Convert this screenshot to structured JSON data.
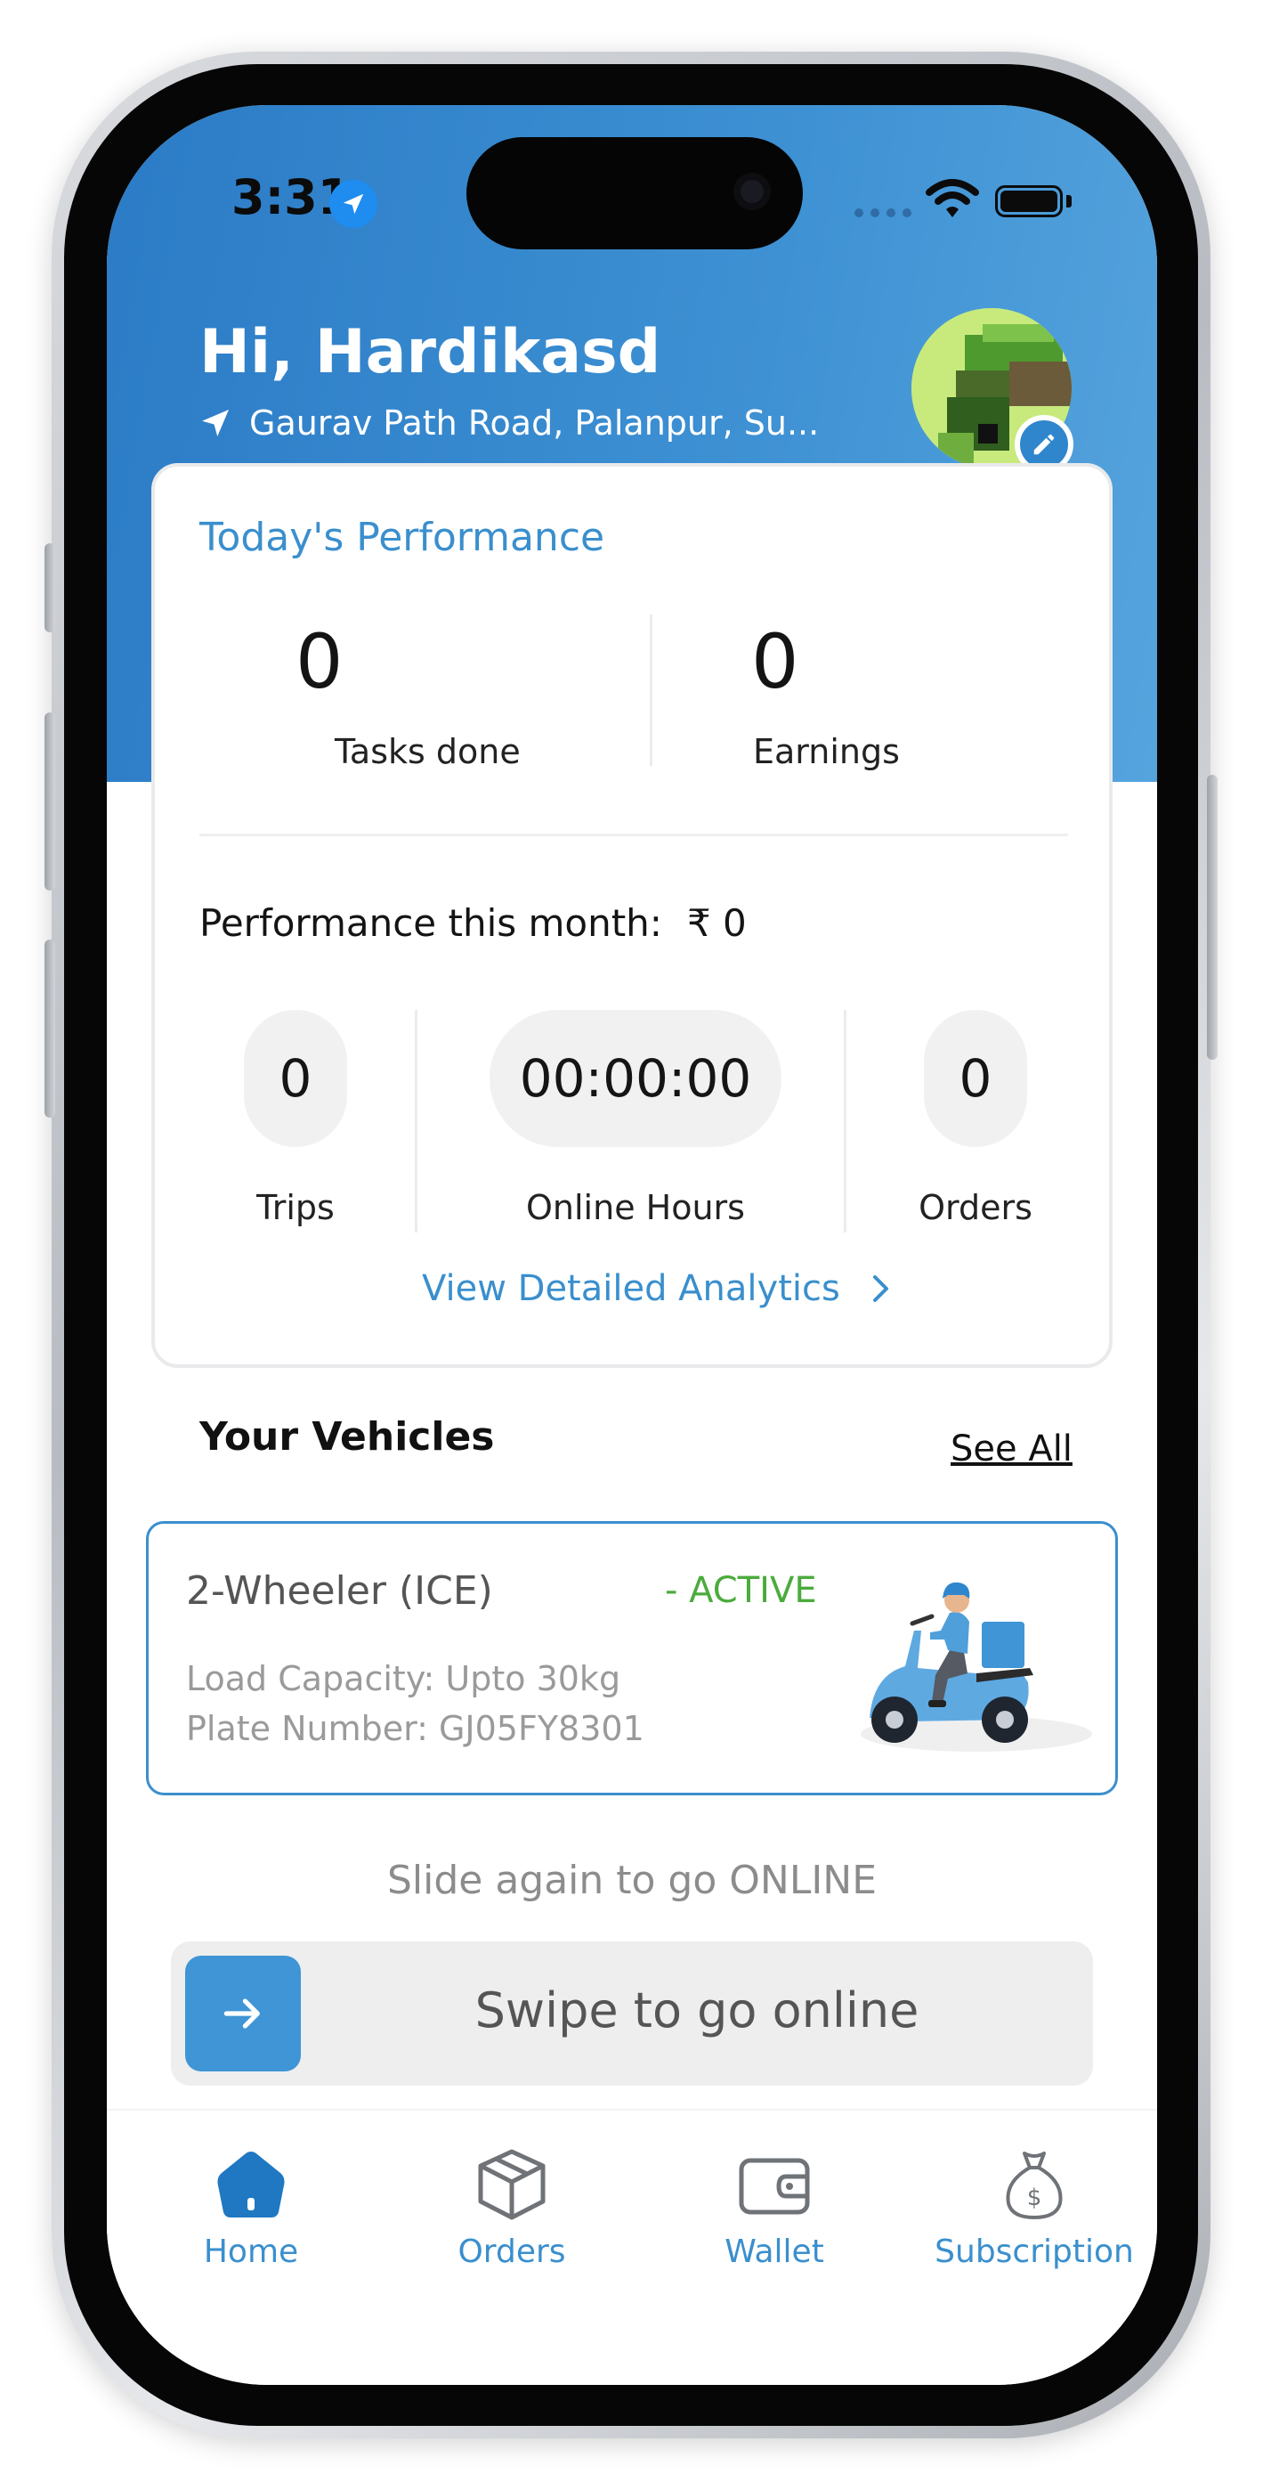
{
  "status_bar": {
    "time": "3:31"
  },
  "header": {
    "greeting": "Hi, Hardikasd",
    "address": "Gaurav Path Road, Palanpur, Su..."
  },
  "performance": {
    "title": "Today's Performance",
    "tasks_done_value": "0",
    "tasks_done_label": "Tasks done",
    "earnings_value": "0",
    "earnings_label": "Earnings",
    "month_label": "Performance this month:",
    "month_value": "₹ 0",
    "trips_value": "0",
    "trips_label": "Trips",
    "online_hours_value": "00:00:00",
    "online_hours_label": "Online Hours",
    "orders_value": "0",
    "orders_label": "Orders",
    "analytics_link": "View Detailed Analytics"
  },
  "vehicles": {
    "title": "Your Vehicles",
    "see_all": "See All",
    "items": [
      {
        "type": "2-Wheeler (ICE)",
        "status": "-  ACTIVE",
        "load_capacity": "Load Capacity: Upto 30kg",
        "plate_number": "Plate Number: GJ05FY8301"
      }
    ]
  },
  "slide": {
    "hint": "Slide again to go ONLINE",
    "label": "Swipe to go online"
  },
  "bottom_nav": {
    "items": [
      {
        "label": "Home",
        "icon": "home-icon"
      },
      {
        "label": "Orders",
        "icon": "box-icon"
      },
      {
        "label": "Wallet",
        "icon": "wallet-icon"
      },
      {
        "label": "Subscription",
        "icon": "money-bag-icon"
      }
    ]
  },
  "colors": {
    "header_blue": "#3e91d3",
    "accent_blue": "#3a8fcd",
    "active_green": "#4bab3c"
  }
}
